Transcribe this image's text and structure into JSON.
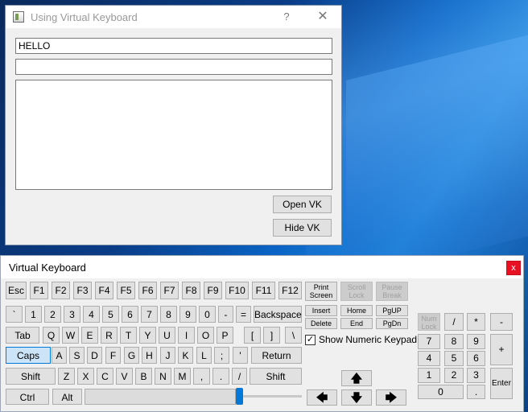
{
  "dialog": {
    "title": "Using Virtual Keyboard",
    "help_label": "?",
    "close_label": "✕",
    "input1_value": "HELLO",
    "input2_value": "",
    "textarea_value": "",
    "open_vk_label": "Open VK",
    "hide_vk_label": "Hide VK"
  },
  "keyboard": {
    "title": "Virtual Keyboard",
    "close_label": "x",
    "function_row": [
      "Esc",
      "F1",
      "F2",
      "F3",
      "F4",
      "F5",
      "F6",
      "F7",
      "F8",
      "F9",
      "F10",
      "F11",
      "F12"
    ],
    "special_keys": {
      "print_screen": "Print Screen",
      "scroll_lock": "Scroll Lock",
      "pause_break": "Pause Break",
      "insert": "Insert",
      "home": "Home",
      "pgup": "PgUP",
      "delete": "Delete",
      "end": "End",
      "pgdn": "PgDn"
    },
    "number_row": [
      "`",
      "1",
      "2",
      "3",
      "4",
      "5",
      "6",
      "7",
      "8",
      "9",
      "0",
      "-",
      "=",
      "Backspace"
    ],
    "qwerty_row": [
      "Tab",
      "Q",
      "W",
      "E",
      "R",
      "T",
      "Y",
      "U",
      "I",
      "O",
      "P",
      "[",
      "]",
      "\\"
    ],
    "home_row": [
      "Caps",
      "A",
      "S",
      "D",
      "F",
      "G",
      "H",
      "J",
      "K",
      "L",
      ";",
      "'",
      "Return"
    ],
    "shift_row": [
      "Shift",
      "Z",
      "X",
      "C",
      "V",
      "B",
      "N",
      "M",
      ",",
      ".",
      "/",
      "Shift"
    ],
    "bottom_row": [
      "Ctrl",
      "Alt"
    ],
    "show_numeric_label": "Show Numeric Keypad",
    "show_numeric_checked": "✓",
    "arrows": {
      "up": "🡅",
      "left": "🡄",
      "down": "🡇",
      "right": "🡆"
    },
    "numpad": {
      "numlock": "Num Lock",
      "divide": "/",
      "multiply": "*",
      "minus": "-",
      "plus": "+",
      "enter": "Enter",
      "digits": [
        "7",
        "8",
        "9",
        "4",
        "5",
        "6",
        "1",
        "2",
        "3",
        "0"
      ],
      "dot": "."
    },
    "caps_active": true
  },
  "colors": {
    "accent": "#0078d7",
    "close_red": "#e81123"
  }
}
